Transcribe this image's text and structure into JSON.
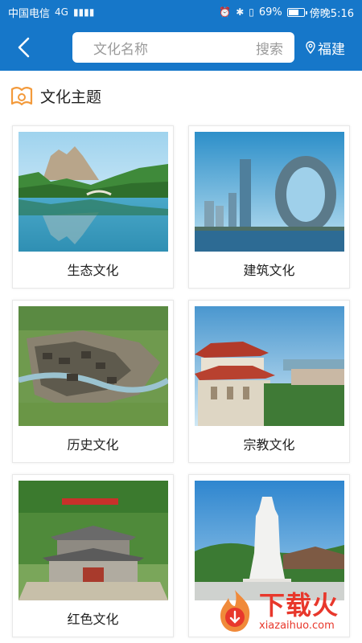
{
  "status_bar": {
    "carrier": "中国电信",
    "network": "4G",
    "battery_text": "69%",
    "battery_level": 0.69,
    "time_text": "傍晚5:16"
  },
  "header": {
    "search_placeholder": "文化名称",
    "search_action": "搜索",
    "location": "福建"
  },
  "section": {
    "title": "文化主题"
  },
  "categories": [
    {
      "label": "生态文化",
      "image": "karst-lake"
    },
    {
      "label": "建筑文化",
      "image": "ring-tower"
    },
    {
      "label": "历史文化",
      "image": "ancient-village"
    },
    {
      "label": "宗教文化",
      "image": "temple-coast"
    },
    {
      "label": "红色文化",
      "image": "red-memorial"
    },
    {
      "label": "",
      "image": "statue"
    }
  ],
  "watermark": {
    "title": "下载火",
    "url": "xiazaihuo.com"
  },
  "colors": {
    "brand_blue": "#1677c9",
    "watermark_red": "#e8382c"
  }
}
